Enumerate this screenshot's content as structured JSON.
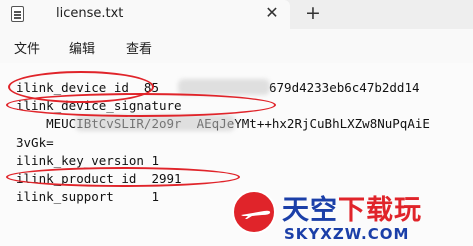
{
  "tab": {
    "title": "license.txt",
    "close_glyph": "✕",
    "new_glyph": "+"
  },
  "menu": {
    "file": "文件",
    "edit": "编辑",
    "view": "查看"
  },
  "lines": [
    "ilink_device_id  85",
    "ilink_device_signature",
    "    MEUCIBtCvSLIR/2o9r  AEqJeYMt++hx2RjCuBhLXZw8NuPqAiE",
    "3vGk=",
    "ilink_key_version 1",
    "ilink_product_id  2991",
    "ilink_support     1"
  ],
  "device_id_tail": "679d4233eb6c47b2dd14",
  "watermark": {
    "cn_part1": "天空",
    "cn_part2": "下载玩",
    "en": "SKYXZW.COM"
  },
  "colors": {
    "annotation": "#e0242a",
    "brand_blue": "#1b3fa8"
  }
}
